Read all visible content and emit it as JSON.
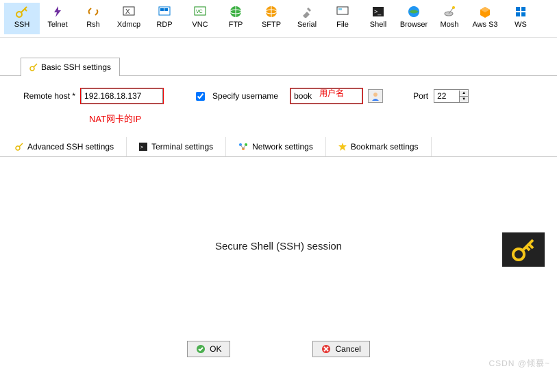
{
  "toolbar": [
    {
      "label": "SSH",
      "icon": "key",
      "active": true
    },
    {
      "label": "Telnet",
      "icon": "bolt",
      "active": false
    },
    {
      "label": "Rsh",
      "icon": "link",
      "active": false
    },
    {
      "label": "Xdmcp",
      "icon": "xdm",
      "active": false
    },
    {
      "label": "RDP",
      "icon": "rdp",
      "active": false
    },
    {
      "label": "VNC",
      "icon": "vnc",
      "active": false
    },
    {
      "label": "FTP",
      "icon": "globe-green",
      "active": false
    },
    {
      "label": "SFTP",
      "icon": "globe-orange",
      "active": false
    },
    {
      "label": "Serial",
      "icon": "plug",
      "active": false
    },
    {
      "label": "File",
      "icon": "screen",
      "active": false
    },
    {
      "label": "Shell",
      "icon": "terminal",
      "active": false
    },
    {
      "label": "Browser",
      "icon": "globe-blue",
      "active": false
    },
    {
      "label": "Mosh",
      "icon": "dish",
      "active": false
    },
    {
      "label": "Aws S3",
      "icon": "cube",
      "active": false
    },
    {
      "label": "WS",
      "icon": "win",
      "active": false
    }
  ],
  "basicTab": {
    "label": "Basic SSH settings"
  },
  "form": {
    "remoteHostLabel": "Remote host *",
    "remoteHostValue": "192.168.18.137",
    "natNote": "NAT网卡的IP",
    "specifyUsernameLabel": "Specify username",
    "specifyUsernameChecked": true,
    "usernameValue": "book",
    "usernameNote": "用户名",
    "portLabel": "Port",
    "portValue": "22"
  },
  "subTabs": [
    {
      "label": "Advanced SSH settings",
      "icon": "key"
    },
    {
      "label": "Terminal settings",
      "icon": "terminal"
    },
    {
      "label": "Network settings",
      "icon": "net"
    },
    {
      "label": "Bookmark settings",
      "icon": "star"
    }
  ],
  "mainText": "Secure Shell (SSH) session",
  "buttons": {
    "ok": "OK",
    "cancel": "Cancel"
  },
  "watermark": "CSDN @倾慕~"
}
